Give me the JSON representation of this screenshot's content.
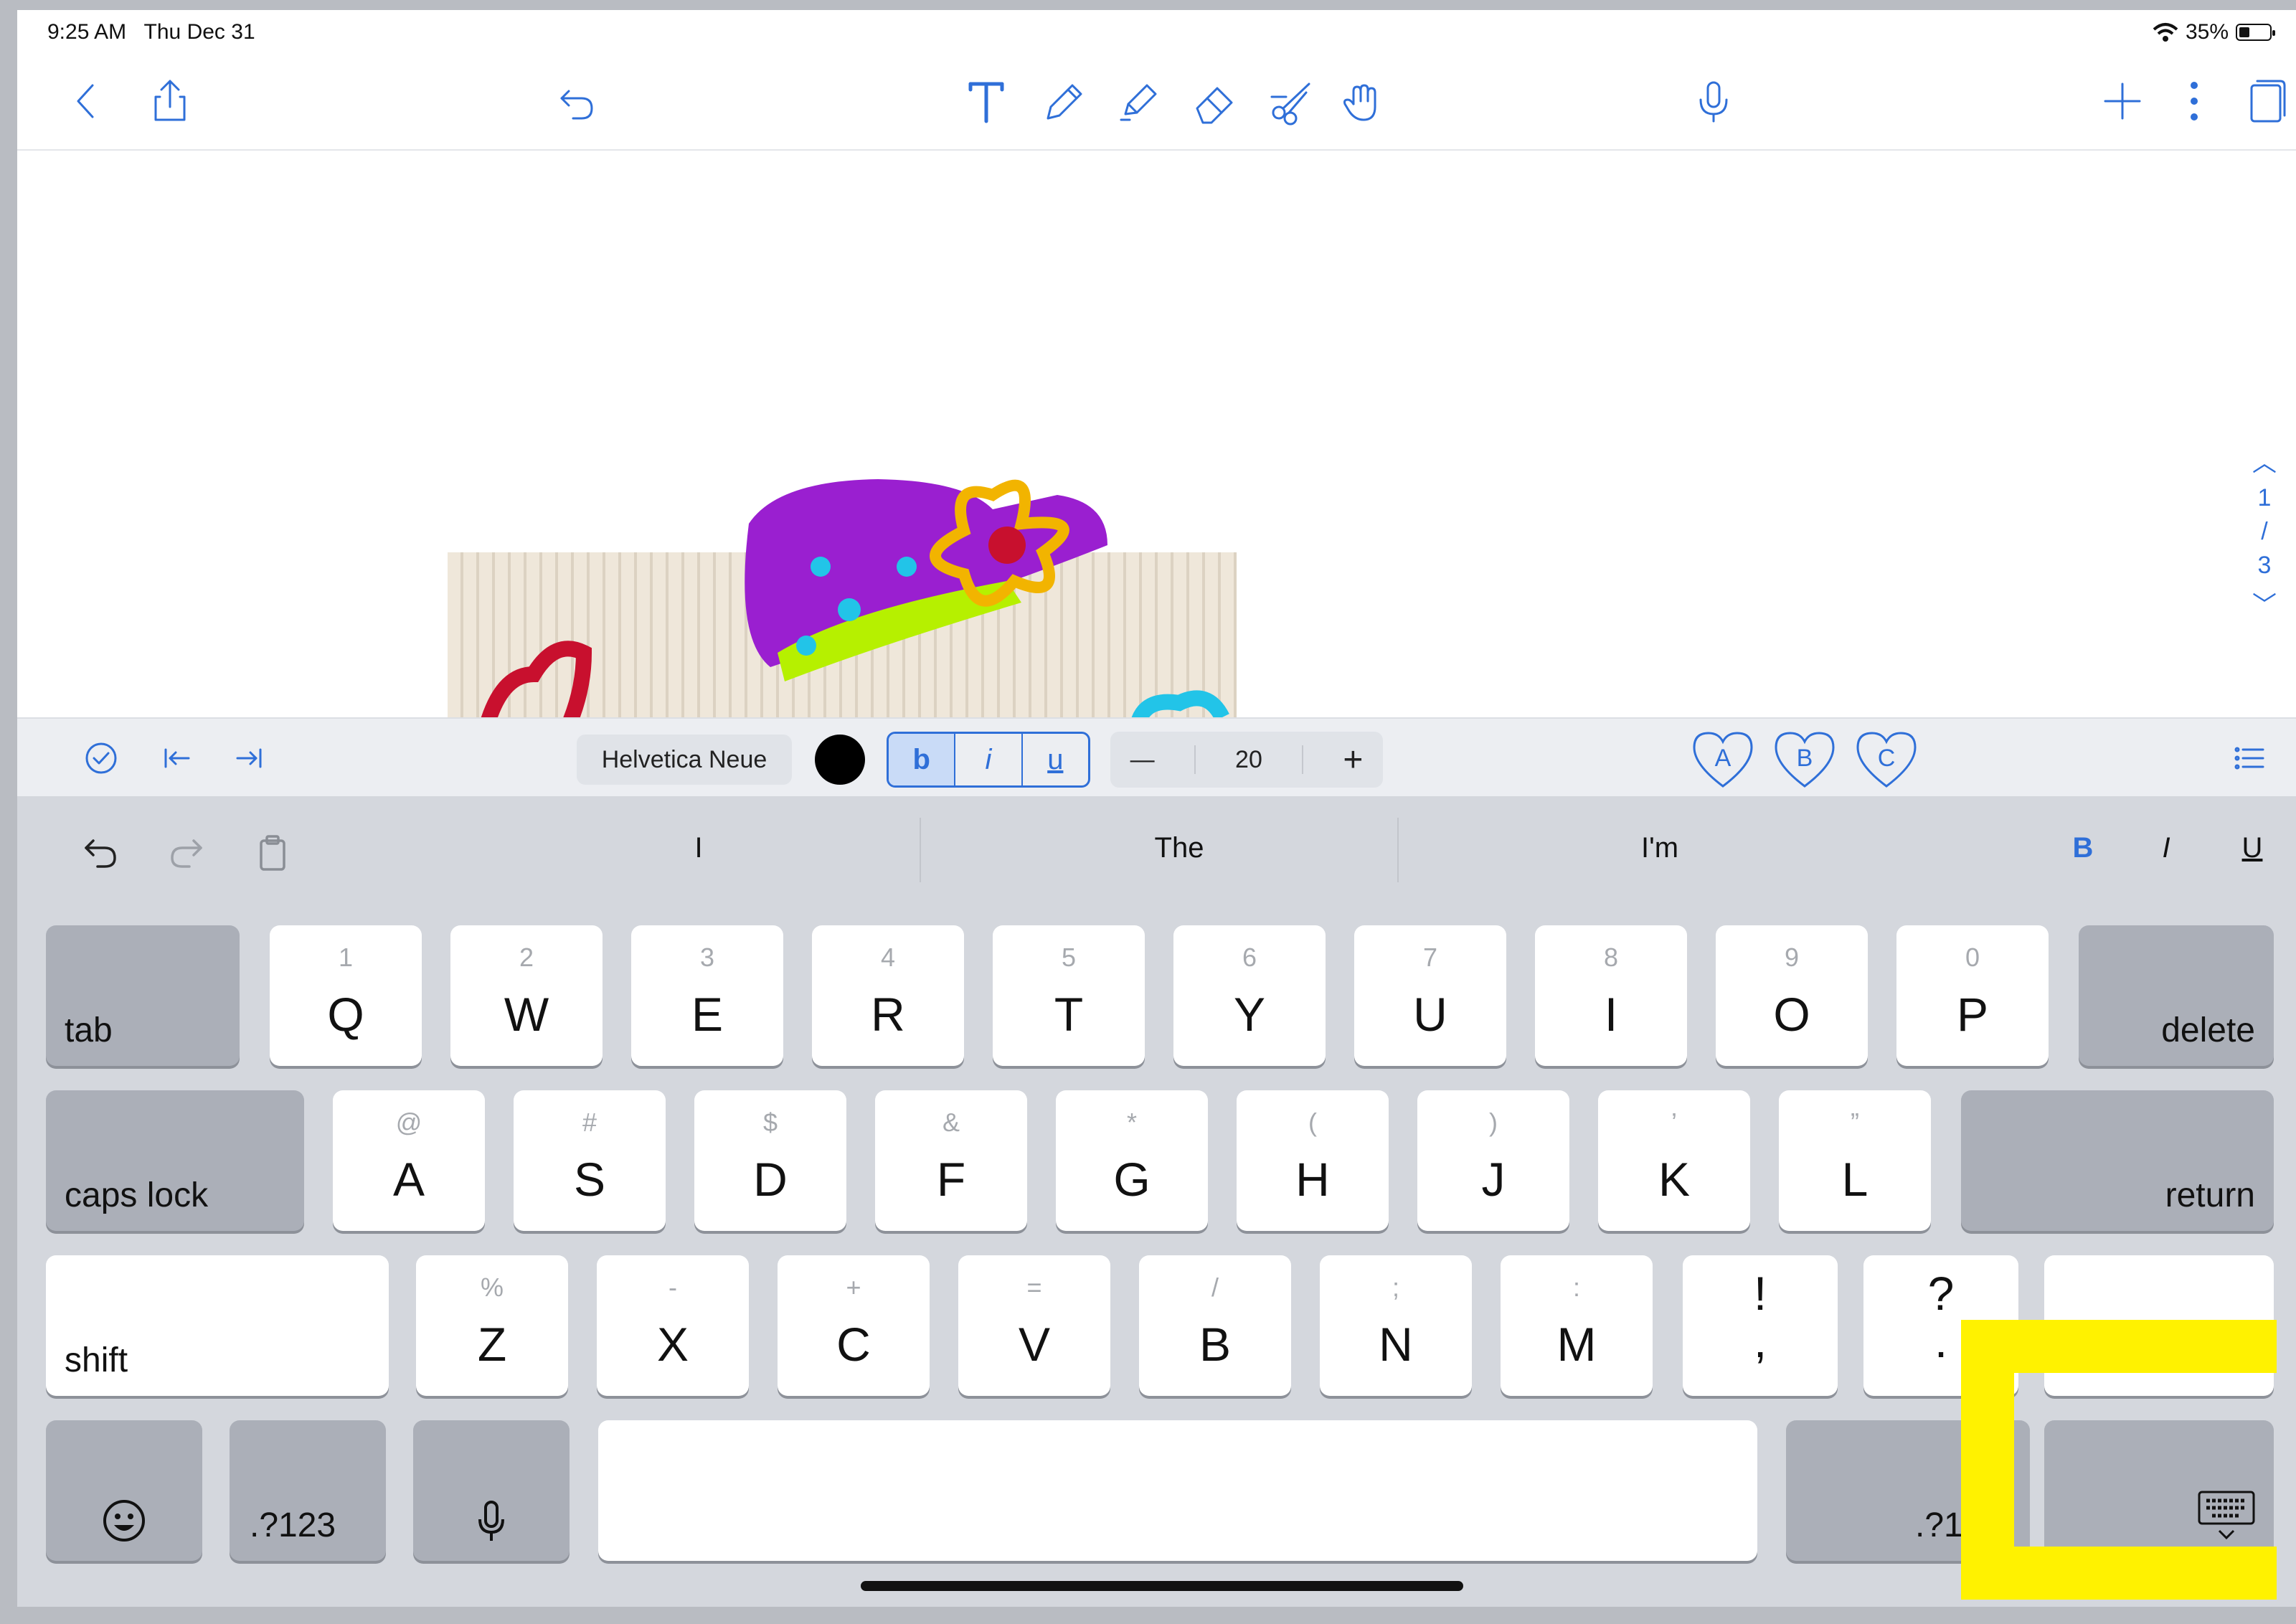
{
  "status": {
    "time": "9:25 AM",
    "date": "Thu Dec 31",
    "battery": "35%"
  },
  "toolbar": {
    "icons": [
      "back-icon",
      "share-icon",
      "undo-icon",
      "text-tool-icon",
      "pen-icon",
      "highlighter-icon",
      "eraser-icon",
      "scissors-icon",
      "hand-icon",
      "microphone-icon",
      "plus-icon",
      "more-icon",
      "pages-icon"
    ]
  },
  "pages": {
    "current": "1",
    "sep": "/",
    "total": "3"
  },
  "format": {
    "font": "Helvetica Neue",
    "color": "#000000",
    "bold": "b",
    "italic": "i",
    "underline": "u",
    "size_minus": "—",
    "size": "20",
    "size_plus": "+",
    "hearts": [
      "A",
      "B",
      "C"
    ]
  },
  "predictions": [
    "I",
    "The",
    "I'm"
  ],
  "format_keys": {
    "bold": "B",
    "italic": "I",
    "underline": "U"
  },
  "keyboard": {
    "row1": [
      {
        "sub": "1",
        "main": "Q"
      },
      {
        "sub": "2",
        "main": "W"
      },
      {
        "sub": "3",
        "main": "E"
      },
      {
        "sub": "4",
        "main": "R"
      },
      {
        "sub": "5",
        "main": "T"
      },
      {
        "sub": "6",
        "main": "Y"
      },
      {
        "sub": "7",
        "main": "U"
      },
      {
        "sub": "8",
        "main": "I"
      },
      {
        "sub": "9",
        "main": "O"
      },
      {
        "sub": "0",
        "main": "P"
      }
    ],
    "row2": [
      {
        "sub": "@",
        "main": "A"
      },
      {
        "sub": "#",
        "main": "S"
      },
      {
        "sub": "$",
        "main": "D"
      },
      {
        "sub": "&",
        "main": "F"
      },
      {
        "sub": "*",
        "main": "G"
      },
      {
        "sub": "(",
        "main": "H"
      },
      {
        "sub": ")",
        "main": "J"
      },
      {
        "sub": "’",
        "main": "K"
      },
      {
        "sub": "”",
        "main": "L"
      }
    ],
    "row3": [
      {
        "sub": "%",
        "main": "Z"
      },
      {
        "sub": "-",
        "main": "X"
      },
      {
        "sub": "+",
        "main": "C"
      },
      {
        "sub": "=",
        "main": "V"
      },
      {
        "sub": "/",
        "main": "B"
      },
      {
        "sub": ";",
        "main": "N"
      },
      {
        "sub": ":",
        "main": "M"
      }
    ],
    "punct1": {
      "top": "!",
      "bottom": ","
    },
    "punct2": {
      "top": "?",
      "bottom": "."
    },
    "tab": "tab",
    "delete": "delete",
    "caps": "caps lock",
    "return": "return",
    "shift": "shift",
    "numbers": ".?123",
    "numbers_right": ".?1"
  }
}
